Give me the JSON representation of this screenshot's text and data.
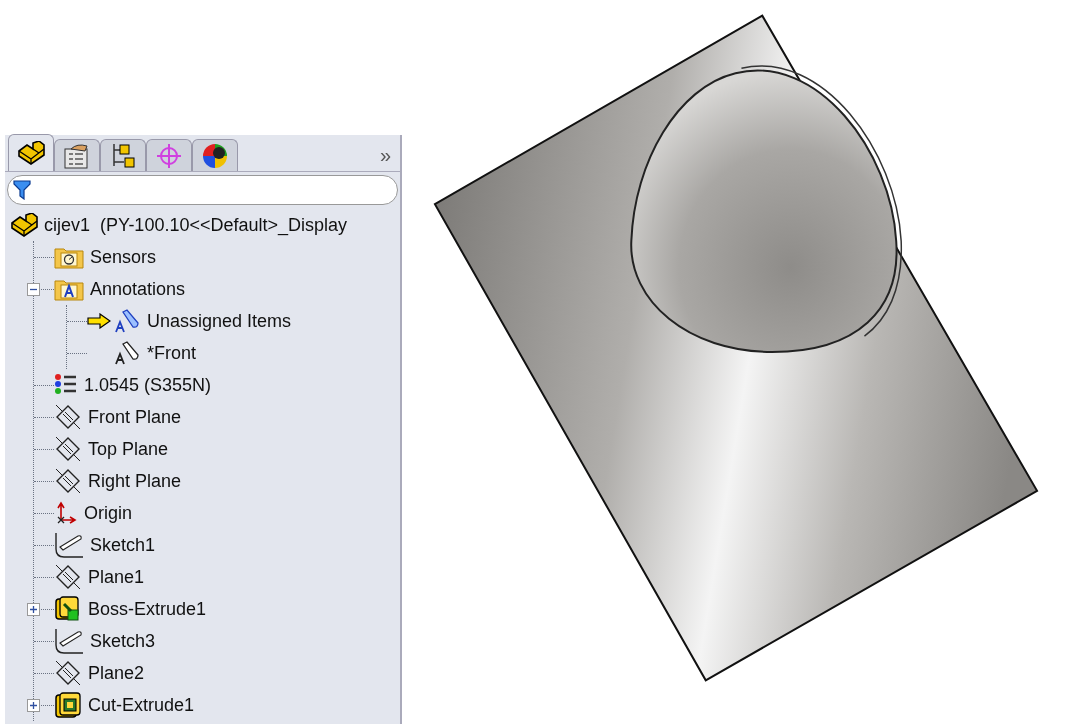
{
  "panel": {
    "tabs": [
      {
        "kind": "feature-manager",
        "selected": true
      },
      {
        "kind": "property-manager",
        "selected": false
      },
      {
        "kind": "configuration-manager",
        "selected": false
      },
      {
        "kind": "dimxpert",
        "selected": false
      },
      {
        "kind": "display-manager",
        "selected": false
      }
    ],
    "more": "»",
    "filter": {
      "kind": "filter"
    },
    "tree": {
      "kind": "part",
      "label": "cijev1  (PY-100.10<<Default>_Display",
      "children": [
        {
          "kind": "sensors",
          "label": "Sensors"
        },
        {
          "kind": "annotations",
          "label": "Annotations",
          "expanded": true,
          "children": [
            {
              "kind": "annotation-view",
              "label": "Unassigned Items",
              "active": true
            },
            {
              "kind": "annotation-view",
              "label": "*Front",
              "active": false
            }
          ]
        },
        {
          "kind": "material",
          "label": "1.0545 (S355N)"
        },
        {
          "kind": "plane",
          "label": "Front Plane"
        },
        {
          "kind": "plane",
          "label": "Top Plane"
        },
        {
          "kind": "plane",
          "label": "Right Plane"
        },
        {
          "kind": "origin",
          "label": "Origin"
        },
        {
          "kind": "sketch",
          "label": "Sketch1"
        },
        {
          "kind": "plane",
          "label": "Plane1"
        },
        {
          "kind": "boss",
          "label": "Boss-Extrude1",
          "expanded": false
        },
        {
          "kind": "sketch",
          "label": "Sketch3"
        },
        {
          "kind": "plane",
          "label": "Plane2"
        },
        {
          "kind": "cut",
          "label": "Cut-Extrude1",
          "expanded": false
        }
      ]
    }
  },
  "viewport": {
    "model": {
      "kind": "part"
    }
  }
}
